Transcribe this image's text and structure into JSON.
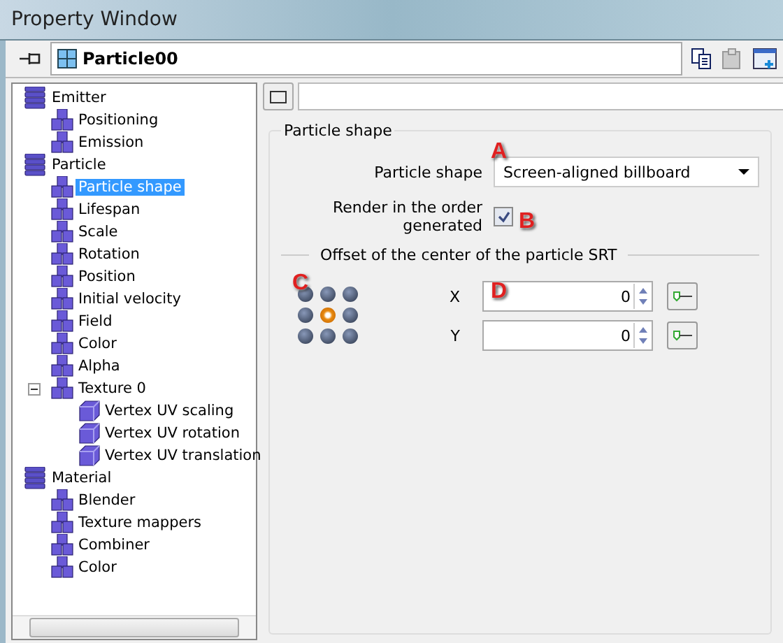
{
  "window": {
    "title": "Property Window"
  },
  "toolbar": {
    "object": "Particle00"
  },
  "tree": [
    {
      "label": "Emitter",
      "selected": false,
      "children": [
        {
          "label": "Positioning",
          "selected": false
        },
        {
          "label": "Emission",
          "selected": false
        }
      ]
    },
    {
      "label": "Particle",
      "selected": false,
      "children": [
        {
          "label": "Particle shape",
          "selected": true
        },
        {
          "label": "Lifespan",
          "selected": false
        },
        {
          "label": "Scale",
          "selected": false
        },
        {
          "label": "Rotation",
          "selected": false
        },
        {
          "label": "Position",
          "selected": false
        },
        {
          "label": "Initial velocity",
          "selected": false
        },
        {
          "label": "Field",
          "selected": false
        },
        {
          "label": "Color",
          "selected": false
        },
        {
          "label": "Alpha",
          "selected": false
        },
        {
          "label": "Texture 0",
          "selected": false,
          "expanded": true,
          "children": [
            {
              "label": "Vertex UV scaling",
              "selected": false
            },
            {
              "label": "Vertex UV rotation",
              "selected": false
            },
            {
              "label": "Vertex UV translation",
              "selected": false
            }
          ]
        }
      ]
    },
    {
      "label": "Material",
      "selected": false,
      "children": [
        {
          "label": "Blender",
          "selected": false
        },
        {
          "label": "Texture mappers",
          "selected": false
        },
        {
          "label": "Combiner",
          "selected": false
        },
        {
          "label": "Color",
          "selected": false
        }
      ]
    }
  ],
  "group": {
    "title": "Particle shape",
    "shape": {
      "label": "Particle shape",
      "value": "Screen-aligned billboard"
    },
    "render_order": {
      "label": "Render in the order generated",
      "checked": true
    },
    "offset": {
      "title": "Offset of the center of the particle SRT",
      "pivot": [
        {
          "selected": false
        },
        {
          "selected": false
        },
        {
          "selected": false
        },
        {
          "selected": false
        },
        {
          "selected": true
        },
        {
          "selected": false
        },
        {
          "selected": false
        },
        {
          "selected": false
        },
        {
          "selected": false
        }
      ],
      "fields": [
        {
          "label": "X",
          "value": "0"
        },
        {
          "label": "Y",
          "value": "0"
        }
      ]
    }
  },
  "callouts": [
    "A",
    "B",
    "C",
    "D"
  ]
}
